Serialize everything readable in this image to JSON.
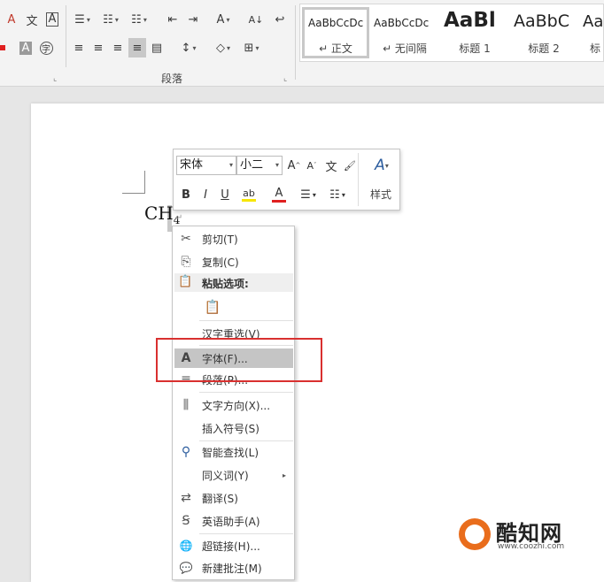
{
  "ribbon": {
    "paragraph_group_label": "段落",
    "dialog_launcher": "⌞",
    "glyphs": {
      "clear_format": "A",
      "phonetic": "文",
      "border_char": "A",
      "bullets": "☰",
      "numbering": "☷",
      "multilevel": "☷",
      "decrease_indent": "⇤",
      "increase_indent": "⇥",
      "asian_layout": "A",
      "sort": "A↓",
      "show_marks": "↩",
      "shading_char": "A",
      "enclose_char": "字",
      "align_left": "≡",
      "align_center": "≡",
      "align_right": "≡",
      "justify": "≡",
      "distributed": "▤",
      "line_spacing": "↕",
      "shading": "◇",
      "borders": "⊞",
      "dropdown": "▾"
    }
  },
  "styles": [
    {
      "sample": "AaBbCcDc",
      "name": "↵ 正文",
      "selected": true
    },
    {
      "sample": "AaBbCcDc",
      "name": "↵ 无间隔",
      "selected": false
    },
    {
      "sample": "AaBl",
      "name": "标题 1",
      "selected": false
    },
    {
      "sample": "AaBbC",
      "name": "标题 2",
      "selected": false
    },
    {
      "sample": "Aa",
      "name": "标",
      "selected": false
    }
  ],
  "document": {
    "text_main": "CH",
    "text_sub": "4",
    "para_mark": "↵"
  },
  "mini_toolbar": {
    "font_name": "宋体",
    "font_size": "小二",
    "grow": "A",
    "shrink": "A",
    "phonetic": "文",
    "format_painter": "🖌",
    "bold": "B",
    "italic": "I",
    "underline": "U",
    "highlight": "ab",
    "font_color": "A",
    "bullets": "☰",
    "numbering": "☷",
    "styles_icon": "A",
    "styles_label": "样式",
    "dropdown": "▾"
  },
  "context_menu": {
    "items": [
      {
        "label": "剪切(T)",
        "icon": "✂"
      },
      {
        "label": "复制(C)",
        "icon": "⎘"
      },
      {
        "label": "粘贴选项:",
        "icon": "📋"
      },
      {
        "label": "汉字重选(V)",
        "icon": ""
      },
      {
        "label": "字体(F)...",
        "icon": "A"
      },
      {
        "label": "段落(P)...",
        "icon": "≡"
      },
      {
        "label": "文字方向(X)...",
        "icon": "⫼"
      },
      {
        "label": "插入符号(S)",
        "icon": ""
      },
      {
        "label": "智能查找(L)",
        "icon": "⚲"
      },
      {
        "label": "同义词(Y)",
        "icon": "",
        "submenu": "▸"
      },
      {
        "label": "翻译(S)",
        "icon": "⇄"
      },
      {
        "label": "英语助手(A)",
        "icon": "Ꞩ"
      },
      {
        "label": "超链接(H)...",
        "icon": "🌐"
      },
      {
        "label": "新建批注(M)",
        "icon": "💬"
      }
    ],
    "paste_option_icon": "📋"
  },
  "watermark": {
    "name": "酷知网",
    "url": "www.coozhi.com"
  },
  "colors": {
    "highlight_box": "#d9302f",
    "menu_highlight": "#c5c5c5",
    "font_color_bar": "#e02020",
    "highlight_bar": "#f7e600"
  }
}
